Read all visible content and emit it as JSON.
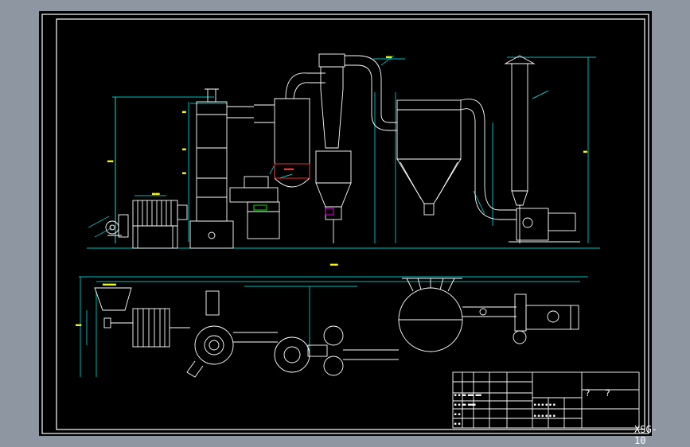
{
  "title_block": {
    "drawing_code": "XSG-10",
    "title_marks": "? ?"
  },
  "colors": {
    "background": "#000000",
    "frame": "#ffffff",
    "outer_gray": "#8e96a2",
    "dimension_lines": "#00ffff",
    "equipment": "#ffffff",
    "piping": "#ffffff",
    "accent_highlight": "#ff3030",
    "secondary": "#00ff00",
    "tertiary": "#ff00ff"
  }
}
